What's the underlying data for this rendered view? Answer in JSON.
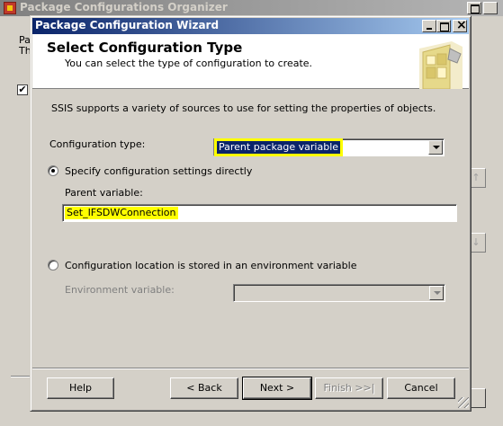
{
  "parent": {
    "title": "Package Configurations Organizer",
    "text_line1": "Pa",
    "text_line2": "Th",
    "side_button_up": "↑",
    "side_button_down": "↓",
    "side_button_checked": "✔"
  },
  "wizard": {
    "title": "Package Configuration Wizard",
    "header": {
      "title": "Select Configuration Type",
      "subtitle": "You can select the type of configuration to create.",
      "art_icon": "wizard-puzzle-icon"
    },
    "intro": "SSIS supports a variety of sources to use for setting the properties of objects.",
    "config_type": {
      "label": "Configuration type:",
      "value": "Parent package variable"
    },
    "option_direct": {
      "label": "Specify configuration settings directly",
      "selected": true
    },
    "parent_variable": {
      "label": "Parent variable:",
      "value": "Set_IFSDWConnection"
    },
    "option_env": {
      "label": "Configuration location is stored in an environment variable",
      "selected": false
    },
    "env_variable": {
      "label": "Environment variable:",
      "value": ""
    },
    "buttons": {
      "help": "Help",
      "back": "< Back",
      "next": "Next >",
      "finish": "Finish >>|",
      "cancel": "Cancel"
    }
  },
  "colors": {
    "titlebar_active": "#0a246a",
    "titlebar_inactive": "#808080",
    "highlight_marker": "#ffff00",
    "selection": "#0a246a"
  }
}
